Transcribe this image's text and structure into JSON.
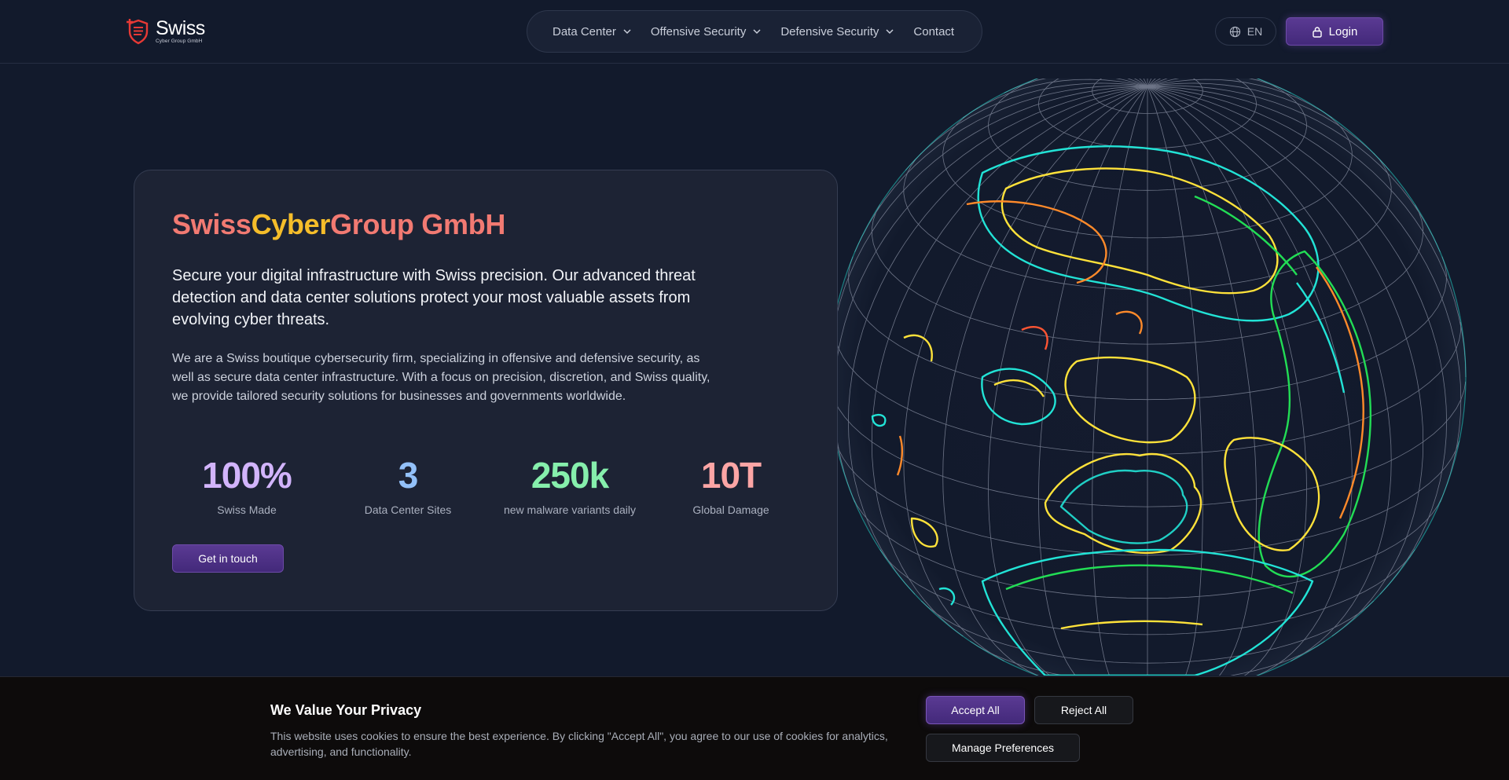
{
  "header": {
    "logo_name": "Swiss",
    "logo_sub": "Cyber Group GmbH",
    "nav": [
      {
        "label": "Data Center",
        "has_dropdown": true
      },
      {
        "label": "Offensive Security",
        "has_dropdown": true
      },
      {
        "label": "Defensive Security",
        "has_dropdown": true
      },
      {
        "label": "Contact",
        "has_dropdown": false
      }
    ],
    "language": "EN",
    "login_label": "Login"
  },
  "hero": {
    "title_part1": "Swiss",
    "title_part2": "Cyber",
    "title_part3": "Group GmbH",
    "lead": "Secure your digital infrastructure with Swiss precision. Our advanced threat detection and data center solutions protect your most valuable assets from evolving cyber threats.",
    "body": "We are a Swiss boutique cybersecurity firm, specializing in offensive and defensive security, as well as secure data center infrastructure. With a focus on precision, discretion, and Swiss quality, we provide tailored security solutions for businesses and governments worldwide.",
    "stats": [
      {
        "value": "100%",
        "label": "Swiss Made",
        "color": "#d2b4fb"
      },
      {
        "value": "3",
        "label": "Data Center Sites",
        "color": "#93c1f9"
      },
      {
        "value": "250k",
        "label": "new malware variants daily",
        "color": "#86efac"
      },
      {
        "value": "10T",
        "label": "Global Damage",
        "color": "#fca5a5"
      }
    ],
    "cta_label": "Get in touch"
  },
  "cookie": {
    "title": "We Value Your Privacy",
    "text": "This website uses cookies to ensure the best experience. By clicking \"Accept All\", you agree to our use of cookies for analytics, advertising, and functionality.",
    "accept_label": "Accept All",
    "reject_label": "Reject All",
    "manage_label": "Manage Preferences"
  },
  "colors": {
    "background": "#121a2c",
    "accent": "#5a3a93",
    "brand_red": "#e53935",
    "title_coral": "#f27a72",
    "title_yellow": "#f5bd2a",
    "globe_cyan": "#22e3d6",
    "globe_yellow": "#ffe23a",
    "globe_green": "#22dd55",
    "globe_orange": "#ff8a2a"
  },
  "icons": {
    "logo": "shield-cross-icon",
    "dropdown": "chevron-down-icon",
    "language": "globe-icon",
    "login": "lock-icon"
  }
}
